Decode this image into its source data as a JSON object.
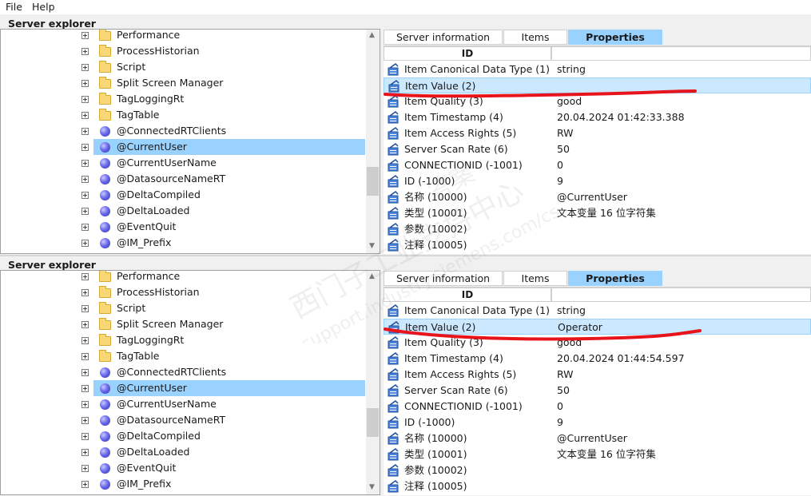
{
  "menu": {
    "file": "File",
    "help": "Help"
  },
  "panels": [
    {
      "title": "Server explorer",
      "tree": [
        {
          "label": "Performance",
          "type": "folder"
        },
        {
          "label": "ProcessHistorian",
          "type": "folder"
        },
        {
          "label": "Script",
          "type": "folder"
        },
        {
          "label": "Split Screen Manager",
          "type": "folder"
        },
        {
          "label": "TagLoggingRt",
          "type": "folder"
        },
        {
          "label": "TagTable",
          "type": "folder"
        },
        {
          "label": "@ConnectedRTClients",
          "type": "tag"
        },
        {
          "label": "@CurrentUser",
          "type": "tag",
          "selected": true
        },
        {
          "label": "@CurrentUserName",
          "type": "tag"
        },
        {
          "label": "@DatasourceNameRT",
          "type": "tag"
        },
        {
          "label": "@DeltaCompiled",
          "type": "tag"
        },
        {
          "label": "@DeltaLoaded",
          "type": "tag"
        },
        {
          "label": "@EventQuit",
          "type": "tag"
        },
        {
          "label": "@IM_Prefix",
          "type": "tag"
        }
      ],
      "tabs": [
        "Server information",
        "Items",
        "Properties"
      ],
      "active_tab": "Properties",
      "columns": {
        "id": "ID",
        "value": ""
      },
      "properties": [
        {
          "name": "Item Canonical Data Type (1)",
          "value": "string"
        },
        {
          "name": "Item Value (2)",
          "value": "",
          "selected": true
        },
        {
          "name": "Item Quality (3)",
          "value": "good"
        },
        {
          "name": "Item Timestamp (4)",
          "value": "20.04.2024 01:42:33.388"
        },
        {
          "name": "Item Access Rights (5)",
          "value": "RW"
        },
        {
          "name": "Server Scan Rate (6)",
          "value": "50"
        },
        {
          "name": "CONNECTIONID (-1001)",
          "value": "0"
        },
        {
          "name": "ID (-1000)",
          "value": "9"
        },
        {
          "name": "名称 (10000)",
          "value": "@CurrentUser"
        },
        {
          "name": "类型 (10001)",
          "value": "文本变量 16 位字符集"
        },
        {
          "name": "参数 (10002)",
          "value": ""
        },
        {
          "name": "注释 (10005)",
          "value": ""
        }
      ]
    },
    {
      "title": "Server explorer",
      "tree": [
        {
          "label": "Performance",
          "type": "folder"
        },
        {
          "label": "ProcessHistorian",
          "type": "folder"
        },
        {
          "label": "Script",
          "type": "folder"
        },
        {
          "label": "Split Screen Manager",
          "type": "folder"
        },
        {
          "label": "TagLoggingRt",
          "type": "folder"
        },
        {
          "label": "TagTable",
          "type": "folder"
        },
        {
          "label": "@ConnectedRTClients",
          "type": "tag"
        },
        {
          "label": "@CurrentUser",
          "type": "tag",
          "selected": true
        },
        {
          "label": "@CurrentUserName",
          "type": "tag"
        },
        {
          "label": "@DatasourceNameRT",
          "type": "tag"
        },
        {
          "label": "@DeltaCompiled",
          "type": "tag"
        },
        {
          "label": "@DeltaLoaded",
          "type": "tag"
        },
        {
          "label": "@EventQuit",
          "type": "tag"
        },
        {
          "label": "@IM_Prefix",
          "type": "tag"
        }
      ],
      "tabs": [
        "Server information",
        "Items",
        "Properties"
      ],
      "active_tab": "Properties",
      "columns": {
        "id": "ID",
        "value": ""
      },
      "properties": [
        {
          "name": "Item Canonical Data Type (1)",
          "value": "string"
        },
        {
          "name": "Item Value (2)",
          "value": "Operator",
          "selected": true
        },
        {
          "name": "Item Quality (3)",
          "value": "good"
        },
        {
          "name": "Item Timestamp (4)",
          "value": "20.04.2024 01:44:54.597"
        },
        {
          "name": "Item Access Rights (5)",
          "value": "RW"
        },
        {
          "name": "Server Scan Rate (6)",
          "value": "50"
        },
        {
          "name": "CONNECTIONID (-1001)",
          "value": "0"
        },
        {
          "name": "ID (-1000)",
          "value": "9"
        },
        {
          "name": "名称 (10000)",
          "value": "@CurrentUser"
        },
        {
          "name": "类型 (10001)",
          "value": "文本变量 16 位字符集"
        },
        {
          "name": "参数 (10002)",
          "value": ""
        },
        {
          "name": "注释 (10005)",
          "value": ""
        }
      ]
    }
  ],
  "watermark": {
    "line1": "西门子工业支持中心",
    "line2": "support.industry.siemens.com/cs",
    "line3": "答案"
  },
  "colors": {
    "selection": "#99d1ff",
    "row_selection": "#cce8ff",
    "annotation": "#e8141c",
    "prop_icon": "#2a6ccf"
  },
  "icons": {
    "folder": "folder-icon",
    "tag": "tag-sphere-icon",
    "property": "property-icon",
    "expander": "expand-plus-icon"
  }
}
